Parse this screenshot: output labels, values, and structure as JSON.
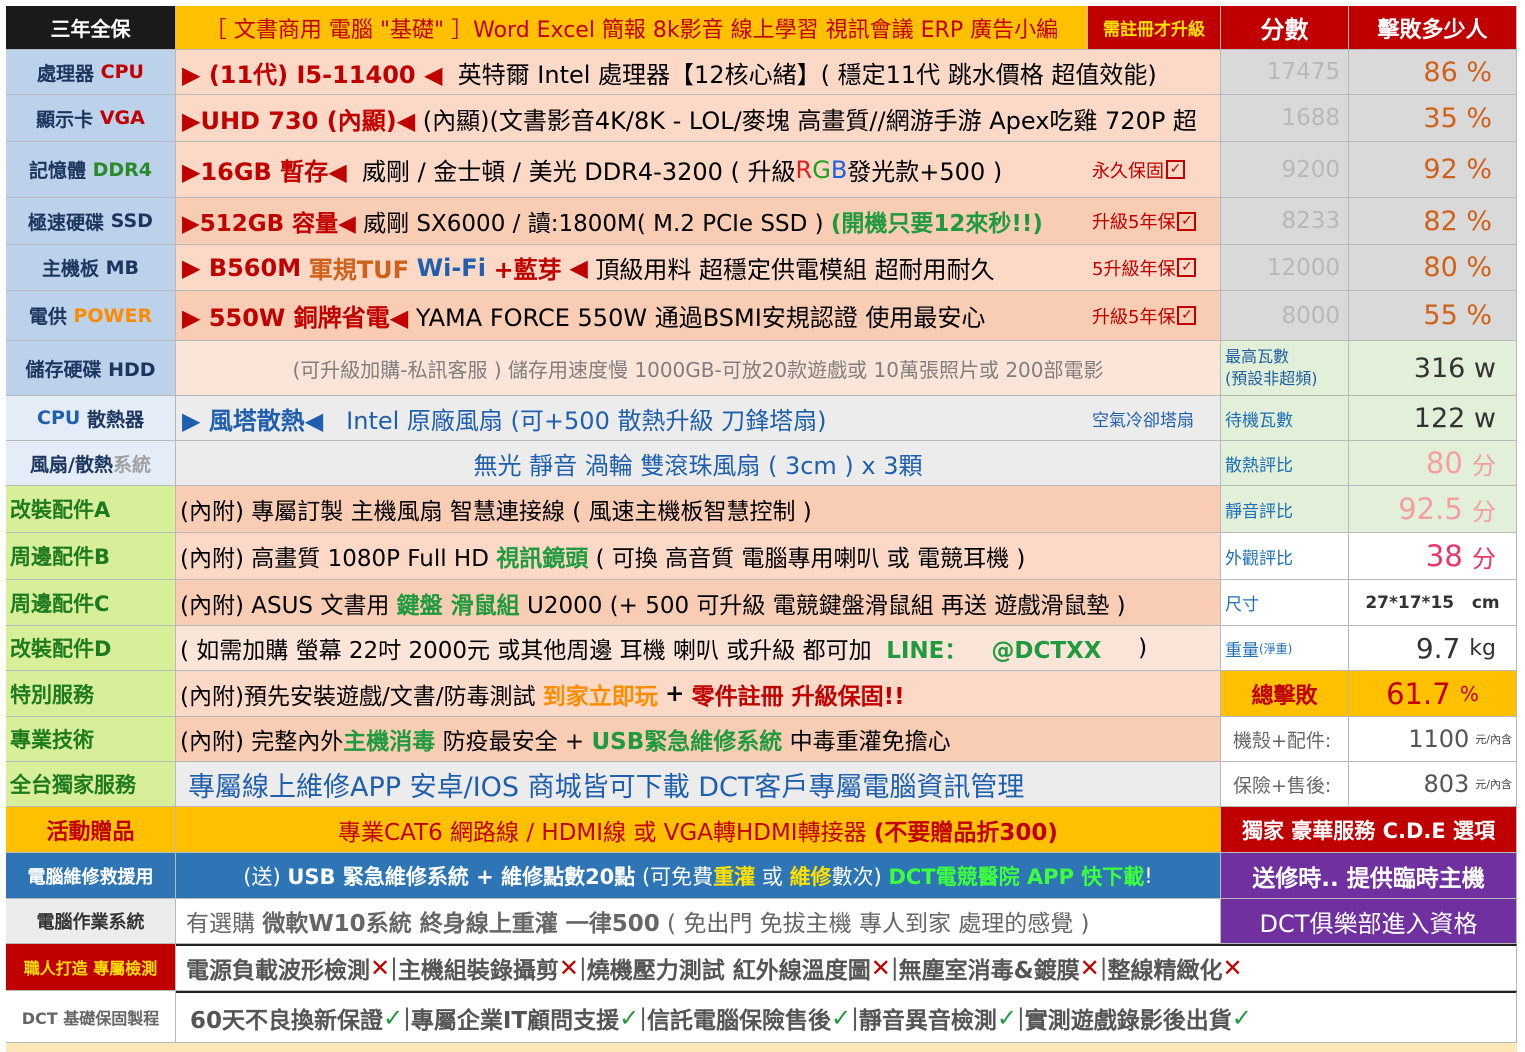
{
  "header": {
    "warranty": "三年全保",
    "title": "［ 文書商用 電腦 \"基礎\" ］Word Excel 簡報 8k影音 線上學習 視訊會議 ERP 廣告小編",
    "register": "需註冊才升級",
    "score": "分數",
    "beat": "擊敗多少人"
  },
  "rows": {
    "cpu": {
      "label_a": "處理器",
      "label_b": "CPU",
      "mark": "▶ (11代) I5-11400 ◀",
      "desc": "英特爾 Intel 處理器【12核心緒】( 穩定11代 跳水價格 超值效能)",
      "score": "17475",
      "pct": "86 %"
    },
    "vga": {
      "label_a": "顯示卡",
      "label_b": "VGA",
      "mark": "▶UHD 730 (內顯)◀",
      "desc": "(內顯)(文書影音4K/8K - LOL/麥塊 高畫質//網游手游 Apex吃雞 720P 超",
      "score": "1688",
      "pct": "35 %"
    },
    "ram": {
      "label_a": "記憶體",
      "label_b": "DDR4",
      "mark": "▶16GB 暫存◀",
      "desc": "威剛 / 金士頓 / 美光  DDR4-3200 (  升級",
      "rgb_r": "R",
      "rgb_g": "G",
      "rgb_b": "B",
      "desc2": "發光款+500 )",
      "warranty": "永久保固",
      "check": "✓",
      "score": "9200",
      "pct": "92 %"
    },
    "ssd": {
      "label_a": "極速硬碟",
      "label_b": "SSD",
      "mark": "▶512GB 容量◀",
      "desc": "威剛 SX6000 / 讀:1800M( M.2 PCIe SSD )",
      "highlight": "(開機只要12來秒!!)",
      "warranty": "升級5年保",
      "check": "✓",
      "score": "8233",
      "pct": "82 %"
    },
    "mb": {
      "label_a": "主機板",
      "label_b": "MB",
      "mark_a": "▶ B560M",
      "mark_b": "軍規TUF",
      "mark_c": "Wi-Fi",
      "mark_d": "+藍芽",
      "mark_e": "◀",
      "desc": "頂級用料 超穩定供電模組 超耐用耐久",
      "warranty": "5升級年保",
      "check": "✓",
      "score": "12000",
      "pct": "80 %"
    },
    "psu": {
      "label_a": "電供",
      "label_b": "POWER",
      "mark": "▶ 550W 銅牌省電◀",
      "desc": "YAMA FORCE 550W 通過BSMI安規認證 使用最安心",
      "warranty": "升級5年保",
      "check": "✓",
      "score": "8000",
      "pct": "55 %"
    },
    "hdd": {
      "label": "儲存硬碟 HDD",
      "desc": "(可升級加購-私訊客服 ) 儲存用速度慢 1000GB-可放20款遊戲或 10萬張照片或 200部電影",
      "side_a": "最高瓦數",
      "side_b": "(預設非超頻)",
      "value": "316",
      "unit": "w"
    },
    "cooler": {
      "label_a": "CPU",
      "label_b": "散熱器",
      "mark": "▶ 風塔散熱◀",
      "desc": "Intel 原廠風扇 (可+500 散熱升級 刀鋒塔扇)",
      "tag": "空氣冷卻塔扇",
      "side": "待機瓦數",
      "value": "122",
      "unit": "w"
    },
    "fan": {
      "label_a": "風扇/散熱",
      "label_b": "系統",
      "desc": "無光 靜音 渦輪 雙滾珠風扇 ( 3cm )  x 3顆",
      "side": "散熱評比",
      "value": "80",
      "unit": "分"
    },
    "accA": {
      "label": "改裝配件A",
      "desc": "(內附) 專屬訂製 主機風扇 智慧連接線 ( 風速主機板智慧控制 )",
      "side": "靜音評比",
      "value": "92.5",
      "unit": "分"
    },
    "accB": {
      "label": "周邊配件B",
      "desc_a": "(內附) 高畫質 1080P Full HD",
      "desc_b": "視訊鏡頭",
      "desc_c": "( 可換 高音質 電腦專用喇叭 或 電競耳機 )",
      "side": "外觀評比",
      "value": "38",
      "unit": "分"
    },
    "accC": {
      "label": "周邊配件C",
      "desc_a": "(內附) ASUS 文書用",
      "desc_b": "鍵盤 滑鼠組",
      "desc_c": "U2000  (+ 500 可升級 電競鍵盤滑鼠組 再送 遊戲滑鼠墊 )",
      "side": "尺寸",
      "value": "27*17*15   cm"
    },
    "accD": {
      "label": "改裝配件D",
      "desc_a": "( 如需加購 螢幕 22吋 2000元 或其他周邊  耳機 喇叭 或升級  都可加",
      "desc_b": "LINE：   @DCTXX",
      "desc_c": ")",
      "side_a": "重量",
      "side_b": "(淨重)",
      "value": "9.7",
      "unit": "kg"
    },
    "service": {
      "label": "特別服務",
      "desc_a": "(內附)預先安裝遊戲/文書/防毒測試",
      "desc_b": "到家立即玩",
      "desc_c": "+",
      "desc_d": "零件註冊 升級保固!!",
      "side": "總擊敗",
      "value": "61.7",
      "unit": "%"
    },
    "tech": {
      "label": "專業技術",
      "desc_a": "(內附)  完整內外",
      "desc_b": "主機消毒",
      "desc_c": "防疫最安全 +",
      "desc_d": "USB緊急維修系統",
      "desc_e": "中毒重灌免擔心",
      "side": "機殼+配件:",
      "value": "1100",
      "unit": "元/內含"
    },
    "exclusive": {
      "label": "全台獨家服務",
      "desc": "專屬線上維修APP 安卓/IOS 商城皆可下載  DCT客戶專屬電腦資訊管理",
      "side": "保險+售後:",
      "value": "803",
      "unit": "元/內含"
    }
  },
  "gift": {
    "label": "活動贈品",
    "desc_a": "專業CAT6 網路線 / HDMI線 或 VGA轉HDMI轉接器",
    "desc_b": "(不要贈品折300)",
    "side": "獨家 豪華服務 C.D.E 選項"
  },
  "repair": {
    "label": "電腦維修救援用",
    "desc_a": "(送)",
    "desc_b": "USB 緊急維修系統 + 維修點數20點",
    "desc_c": "(可免費",
    "desc_d": "重灌",
    "desc_e": "或",
    "desc_f": "維修",
    "desc_g": "數次)",
    "desc_h": "DCT電競醫院 APP 快下載",
    "desc_i": "!",
    "side": "送修時.. 提供臨時主機"
  },
  "os": {
    "label": "電腦作業系統",
    "desc_a": "有選購",
    "desc_b": "微軟W10系統 終身線上重灌 一律500",
    "desc_c": "( 免出門 免拔主機 專人到家 處理的感覺 )",
    "side": "DCT俱樂部進入資格"
  },
  "inspect": {
    "label": "職人打造 專屬檢測",
    "items": [
      "電源負載波形檢測",
      "主機組裝錄攝剪",
      "燒機壓力測試 紅外線溫度圖",
      "無塵室消毒&鍍膜",
      "整線精緻化"
    ],
    "mark": "✕",
    "sep": "|"
  },
  "basic": {
    "label": "DCT 基礎保固製程",
    "items": [
      "60天不良換新保證",
      "專屬企業IT顧問支援",
      "信託電腦保險售後",
      "靜音異音檢測",
      "實測遊戲錄影後出貨"
    ],
    "mark": "✓",
    "sep": "|"
  },
  "colors": {
    "navy": "#1a1a1a",
    "gold": "#ffc000",
    "red": "#c00000",
    "peach": "#fbd9c6",
    "label_blue": "#bcd1ea",
    "lime": "#d8ef9a",
    "purple": "#7030a0",
    "blue": "#2e75b6"
  }
}
